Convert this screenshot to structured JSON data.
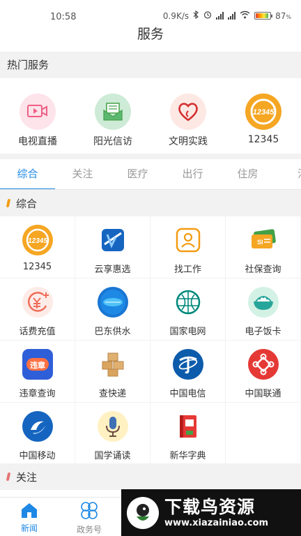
{
  "status": {
    "time": "10:58",
    "speed": "0.9K/s",
    "battery": "87",
    "battery_unit": "%",
    "network1": "4G",
    "network2": "4G"
  },
  "header": {
    "title": "服务"
  },
  "hot": {
    "title": "热门服务",
    "items": [
      {
        "label": "电视直播",
        "icon": "tv-live-icon",
        "color": "#f06292"
      },
      {
        "label": "阳光信访",
        "icon": "envelope-icon",
        "color": "#43a047"
      },
      {
        "label": "文明实践",
        "icon": "heart-icon",
        "color": "#e53935"
      },
      {
        "label": "12345",
        "icon": "hotline-12345-icon",
        "color": "#f5a623"
      }
    ]
  },
  "tabs": [
    {
      "label": "综合",
      "active": true
    },
    {
      "label": "关注"
    },
    {
      "label": "医疗"
    },
    {
      "label": "出行"
    },
    {
      "label": "住房"
    },
    {
      "label": "法"
    }
  ],
  "sections": [
    {
      "title": "综合",
      "items": [
        {
          "label": "12345",
          "icon": "hotline-12345-icon"
        },
        {
          "label": "云享惠选",
          "icon": "cloud-shop-icon"
        },
        {
          "label": "找工作",
          "icon": "job-search-icon"
        },
        {
          "label": "社保查询",
          "icon": "social-security-card-icon"
        },
        {
          "label": "话费充值",
          "icon": "phone-recharge-icon"
        },
        {
          "label": "巴东供水",
          "icon": "water-supply-icon"
        },
        {
          "label": "国家电网",
          "icon": "state-grid-icon"
        },
        {
          "label": "电子饭卡",
          "icon": "meal-card-icon"
        },
        {
          "label": "违章查询",
          "icon": "traffic-violation-icon"
        },
        {
          "label": "查快递",
          "icon": "parcel-icon"
        },
        {
          "label": "中国电信",
          "icon": "china-telecom-icon"
        },
        {
          "label": "中国联通",
          "icon": "china-unicom-icon"
        },
        {
          "label": "中国移动",
          "icon": "china-mobile-icon"
        },
        {
          "label": "国学诵读",
          "icon": "microphone-icon"
        },
        {
          "label": "新华字典",
          "icon": "dictionary-icon"
        }
      ]
    },
    {
      "title": "关注",
      "items": []
    }
  ],
  "bottom_nav": [
    {
      "label": "新闻",
      "icon": "home-icon",
      "active": true
    },
    {
      "label": "政务号",
      "icon": "clover-icon"
    }
  ],
  "watermark": {
    "title": "下载鸟资源",
    "url": "www.xiazainiao.com"
  },
  "icon_text": {
    "hotline": "12345",
    "violation": "违章",
    "social_security": "SI"
  }
}
